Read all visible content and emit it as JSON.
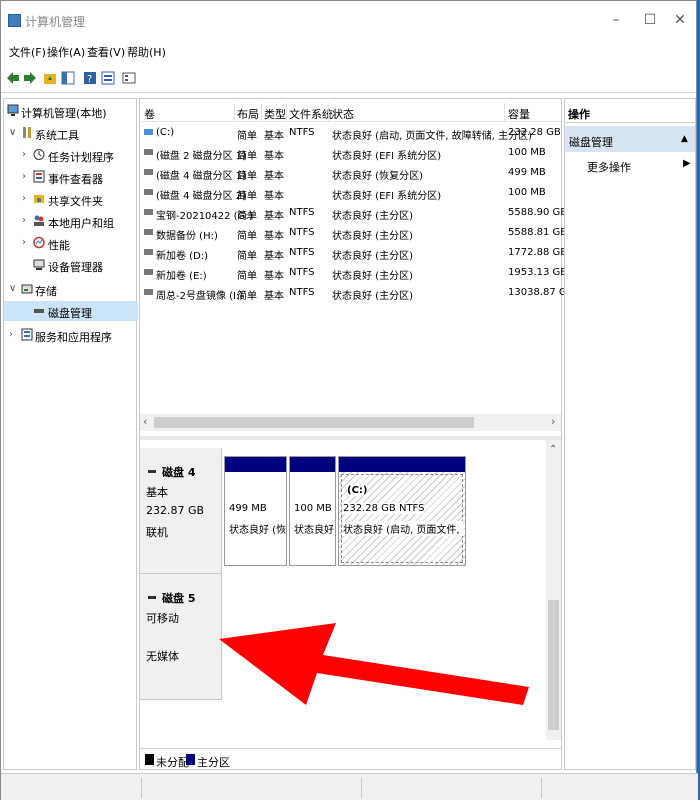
{
  "window": {
    "title": "计算机管理",
    "minimize": "–",
    "maximize": "☐",
    "close": "✕"
  },
  "menu": [
    "文件(F)",
    "操作(A)",
    "查看(V)",
    "帮助(H)"
  ],
  "tree": {
    "root": "计算机管理(本地)",
    "system_tools": "系统工具",
    "task_scheduler": "任务计划程序",
    "event_viewer": "事件查看器",
    "shared_folders": "共享文件夹",
    "local_users": "本地用户和组",
    "performance": "性能",
    "device_manager": "设备管理器",
    "storage": "存储",
    "disk_management": "磁盘管理",
    "services_apps": "服务和应用程序"
  },
  "columns": [
    "卷",
    "布局",
    "类型",
    "文件系统",
    "状态",
    "容量"
  ],
  "volumes": [
    {
      "name": "(C:)",
      "layout": "简单",
      "type": "基本",
      "fs": "NTFS",
      "status": "状态良好 (启动, 页面文件, 故障转储, 主分区)",
      "capacity": "232.28 GB"
    },
    {
      "name": "(磁盘 2 磁盘分区 1)",
      "layout": "简单",
      "type": "基本",
      "fs": "",
      "status": "状态良好 (EFI 系统分区)",
      "capacity": "100 MB"
    },
    {
      "name": "(磁盘 4 磁盘分区 1)",
      "layout": "简单",
      "type": "基本",
      "fs": "",
      "status": "状态良好 (恢复分区)",
      "capacity": "499 MB"
    },
    {
      "name": "(磁盘 4 磁盘分区 2)",
      "layout": "简单",
      "type": "基本",
      "fs": "",
      "status": "状态良好 (EFI 系统分区)",
      "capacity": "100 MB"
    },
    {
      "name": "宝钢-20210422 (G:)",
      "layout": "简单",
      "type": "基本",
      "fs": "NTFS",
      "status": "状态良好 (主分区)",
      "capacity": "5588.90 GB"
    },
    {
      "name": "数据备份 (H:)",
      "layout": "简单",
      "type": "基本",
      "fs": "NTFS",
      "status": "状态良好 (主分区)",
      "capacity": "5588.81 GB"
    },
    {
      "name": "新加卷 (D:)",
      "layout": "简单",
      "type": "基本",
      "fs": "NTFS",
      "status": "状态良好 (主分区)",
      "capacity": "1772.88 GB"
    },
    {
      "name": "新加卷 (E:)",
      "layout": "简单",
      "type": "基本",
      "fs": "NTFS",
      "status": "状态良好 (主分区)",
      "capacity": "1953.13 GB"
    },
    {
      "name": "周总-2号盘镜像 (I:)",
      "layout": "简单",
      "type": "基本",
      "fs": "NTFS",
      "status": "状态良好 (主分区)",
      "capacity": "13038.87 GB"
    }
  ],
  "disk4": {
    "name": "磁盘 4",
    "type": "基本",
    "size": "232.87 GB",
    "state": "联机",
    "partitions": [
      {
        "size": "499 MB",
        "status": "状态良好 (恢复"
      },
      {
        "size": "100 MB",
        "status": "状态良好"
      },
      {
        "label": "(C:)",
        "size": "232.28 GB NTFS",
        "status": "状态良好 (启动, 页面文件, 故障"
      }
    ]
  },
  "disk5": {
    "name": "磁盘 5",
    "type": "可移动",
    "media": "无媒体"
  },
  "legend": [
    {
      "label": "未分配",
      "color": "#000000"
    },
    {
      "label": "主分区",
      "color": "#000080"
    }
  ],
  "actions": {
    "title": "操作",
    "section": "磁盘管理",
    "more": "更多操作"
  },
  "annotation_color": "#ff0000"
}
